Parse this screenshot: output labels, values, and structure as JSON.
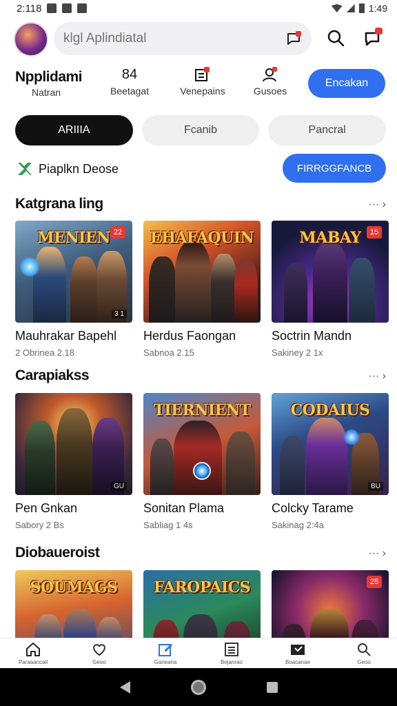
{
  "status_bar": {
    "time": "2:118",
    "right_text": "1:49"
  },
  "search": {
    "placeholder": "klgl Aplindiatal",
    "value": ""
  },
  "brand": {
    "title": "Npplidami",
    "subtitle": "Natran"
  },
  "stats": [
    {
      "value": "84",
      "label": "Beetagat"
    },
    {
      "value": "",
      "label": "Venepains"
    },
    {
      "value": "",
      "label": "Gusoes"
    }
  ],
  "cta_label": "Encakan",
  "tabs": [
    "ARIIIA",
    "Fcanib",
    "Pancral"
  ],
  "promo": {
    "text": "Piaplkn Deose",
    "button": "FIRRGGFANCB"
  },
  "sections": [
    {
      "title": "Katgrana ling",
      "more": "···",
      "cards": [
        {
          "thumb_title": "MENIEN",
          "badge": "22",
          "corner": "3 1",
          "name": "Mauhrakar Bapehl",
          "meta": "2 Obrinea 2.18"
        },
        {
          "thumb_title": "EHAFAQUIN",
          "badge": "",
          "corner": "",
          "name": "Herdus Faongan",
          "meta": "Sabnoa 2.15"
        },
        {
          "thumb_title": "MABAY",
          "badge": "15",
          "corner": "",
          "name": "Soctrin Mandn",
          "meta": "Sakiney 2 1x"
        }
      ]
    },
    {
      "title": "Carapiakss",
      "more": "···",
      "cards": [
        {
          "thumb_title": "",
          "badge": "",
          "corner": "GU",
          "name": "Pen Gnkan",
          "meta": "Sabory 2 Bs"
        },
        {
          "thumb_title": "TIERNIENT",
          "badge": "",
          "corner": "",
          "name": "Sonitan Plama",
          "meta": "Sabliag 1 4s"
        },
        {
          "thumb_title": "CODAIUS",
          "badge": "",
          "corner": "BU",
          "name": "Colcky Tarame",
          "meta": "Sakinag 2:4a"
        }
      ]
    },
    {
      "title": "Diobaueroist",
      "more": "···",
      "cards": [
        {
          "thumb_title": "SOUMAGS",
          "badge": "",
          "corner": "",
          "name": "",
          "meta": ""
        },
        {
          "thumb_title": "FAROPAICS",
          "badge": "",
          "corner": "",
          "name": "",
          "meta": ""
        },
        {
          "thumb_title": "",
          "badge": "25",
          "corner": "",
          "name": "",
          "meta": ""
        }
      ]
    }
  ],
  "bottom_nav": [
    {
      "label": "Paraaancall",
      "icon": "home-icon"
    },
    {
      "label": "Geoo",
      "icon": "heart-icon"
    },
    {
      "label": "Ganeana",
      "icon": "edit-icon"
    },
    {
      "label": "Bejanrao",
      "icon": "list-icon"
    },
    {
      "label": "Boacanae",
      "icon": "tv-icon"
    },
    {
      "label": "Geoo",
      "icon": "search-icon"
    }
  ],
  "colors": {
    "accent": "#2f6ff0",
    "active_tab": "#111111",
    "badge": "#e53935"
  }
}
